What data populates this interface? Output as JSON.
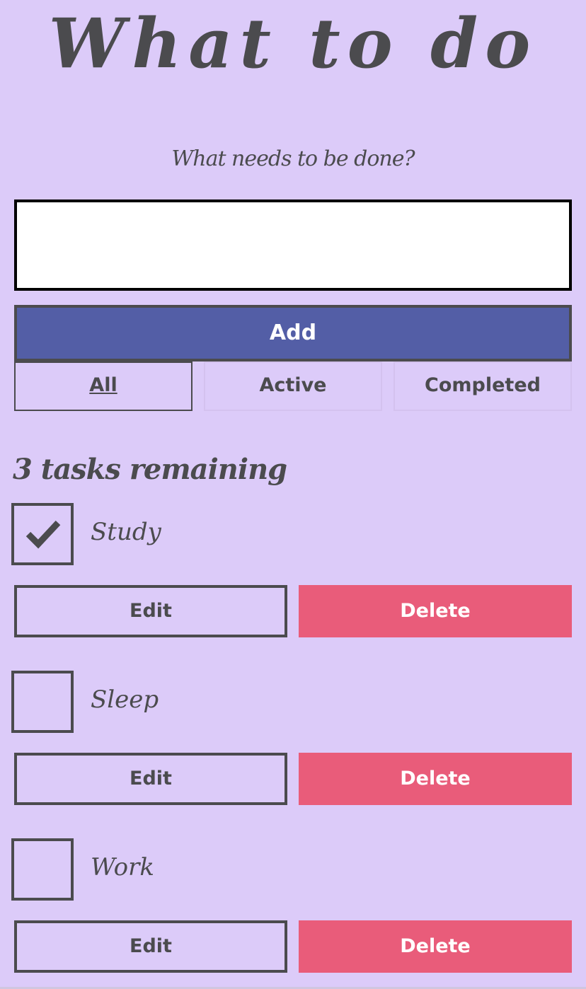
{
  "app": {
    "title": "What to do",
    "prompt": "What needs to be done?"
  },
  "input": {
    "value": "",
    "placeholder": ""
  },
  "add_button": {
    "label": "Add"
  },
  "filters": [
    {
      "label": "All",
      "selected": true
    },
    {
      "label": "Active",
      "selected": false
    },
    {
      "label": "Completed",
      "selected": false
    }
  ],
  "remaining_text": "3 tasks remaining",
  "tasks": [
    {
      "name": "Study",
      "checked": true,
      "edit_label": "Edit",
      "delete_label": "Delete"
    },
    {
      "name": "Sleep",
      "checked": false,
      "edit_label": "Edit",
      "delete_label": "Delete"
    },
    {
      "name": "Work",
      "checked": false,
      "edit_label": "Edit",
      "delete_label": "Delete"
    }
  ],
  "colors": {
    "background": "#dccbf9",
    "text": "#4b4b4e",
    "add_button": "#535ea6",
    "delete_button": "#e95c7a"
  },
  "icons": {
    "checkmark": "check-icon"
  }
}
